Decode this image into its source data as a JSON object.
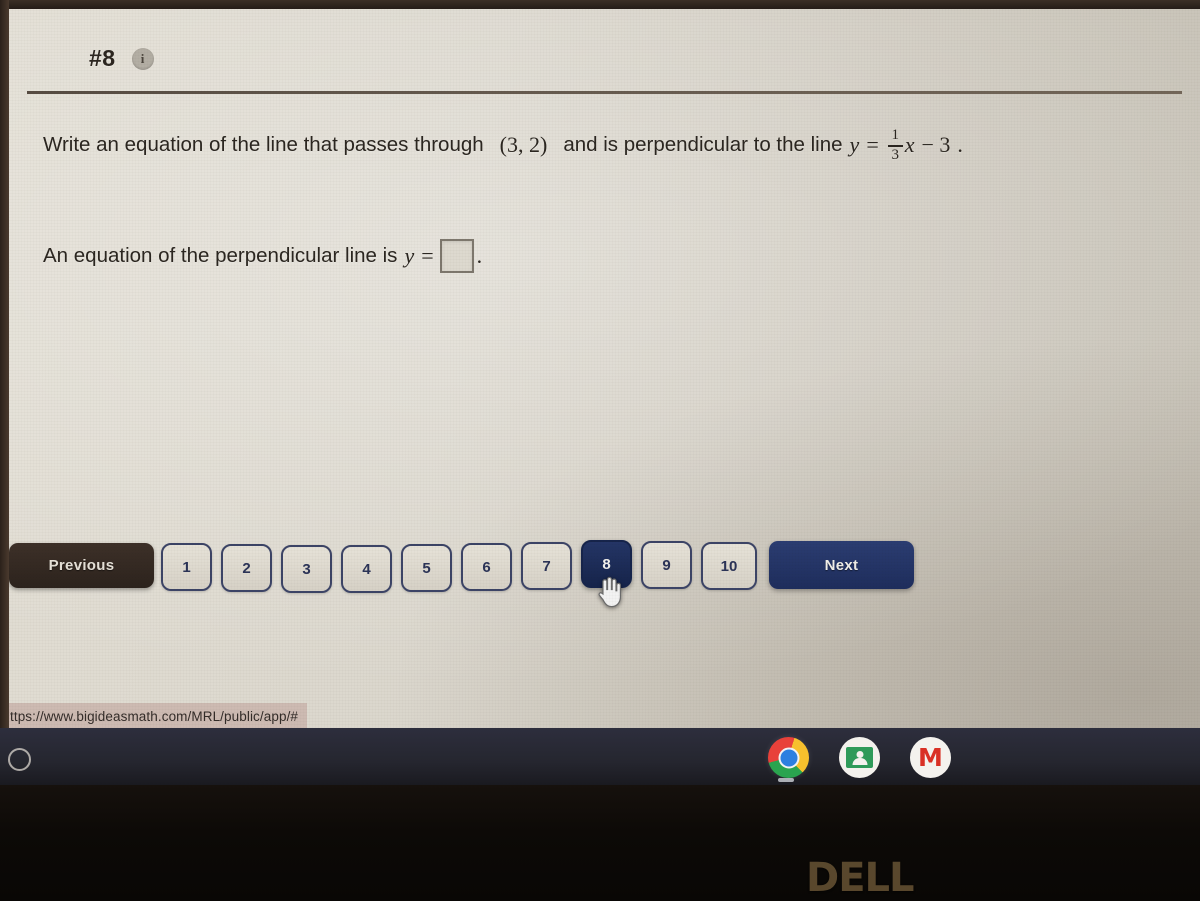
{
  "question": {
    "number_label": "#8",
    "info_icon": "info-icon",
    "prompt_part1": "Write an equation of the line that passes through",
    "point": "(3, 2)",
    "prompt_part2": "and is perpendicular to the line",
    "line_equation": {
      "y": "y",
      "equals": "=",
      "fraction_numerator": "1",
      "fraction_denominator": "3",
      "variable": "x",
      "constant_term": "− 3",
      "period": "."
    },
    "answer_prompt": "An equation of the perpendicular line is",
    "answer_var": "y",
    "answer_equals": "=",
    "answer_value": "",
    "answer_period": "."
  },
  "pager": {
    "previous_label": "Previous",
    "next_label": "Next",
    "pages": [
      "1",
      "2",
      "3",
      "4",
      "5",
      "6",
      "7",
      "8",
      "9",
      "10"
    ],
    "active_page": "8"
  },
  "status_bar": {
    "url": "ttps://www.bigideasmath.com/MRL/public/app/#"
  },
  "shelf": {
    "launcher_icon": "launcher-circle-icon",
    "icons": [
      {
        "name": "chrome-icon",
        "label": "Chrome"
      },
      {
        "name": "google-classroom-icon",
        "label": "Classroom"
      },
      {
        "name": "gmail-icon",
        "label": "M"
      }
    ]
  },
  "device": {
    "brand": "DELL"
  },
  "colors": {
    "accent_navy": "#1e2d5c",
    "previous_dark": "#2c231d",
    "screen_bg": "#d8d4ca",
    "status_bar_bg": "#cdb9b1"
  }
}
